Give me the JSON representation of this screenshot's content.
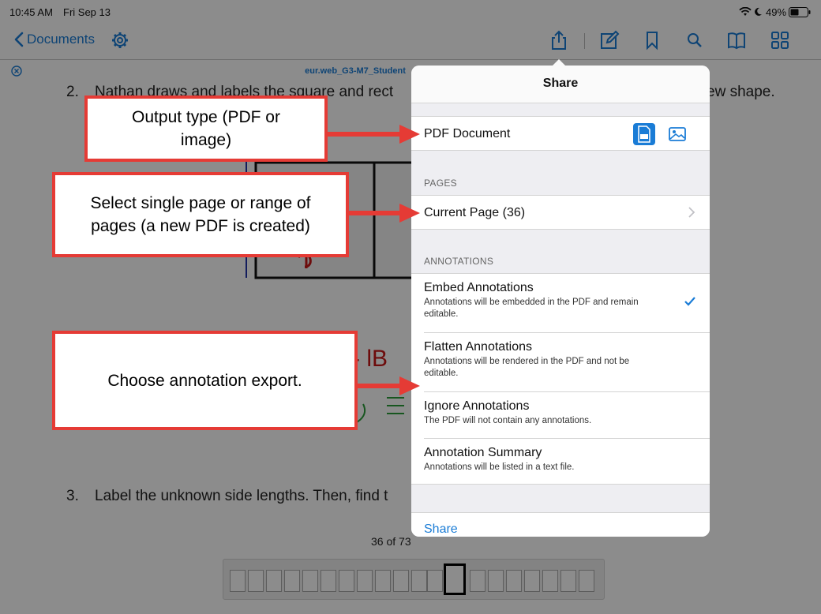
{
  "status": {
    "time": "10:45 AM",
    "date": "Fri Sep 13",
    "battery": "49%"
  },
  "navbar": {
    "back_label": "Documents",
    "icons": [
      "chevron-left-icon",
      "gear-icon",
      "share-icon",
      "edit-icon",
      "bookmark-icon",
      "search-icon",
      "book-icon",
      "grid-icon"
    ]
  },
  "document": {
    "title": "eur.web_G3-M7_Student",
    "q2_number": "2.",
    "q2_text": "Nathan draws and labels the square and rect",
    "q2_tail": "ew shape.",
    "q3_number": "3.",
    "q3_text": "Label the unknown side lengths.  Then, find t",
    "page_counter": "36 of 73"
  },
  "share_popover": {
    "title": "Share",
    "output_row": {
      "label": "PDF Document",
      "selected_format": "pdf"
    },
    "pages_section": "PAGES",
    "pages_row": {
      "label": "Current Page (36)"
    },
    "annotations_section": "ANNOTATIONS",
    "annotation_options": [
      {
        "title": "Embed Annotations",
        "subtitle": "Annotations will be embedded in the PDF and remain editable.",
        "checked": true
      },
      {
        "title": "Flatten Annotations",
        "subtitle": "Annotations will be rendered in the PDF and not be editable.",
        "checked": false
      },
      {
        "title": "Ignore Annotations",
        "subtitle": "The PDF will not contain any annotations.",
        "checked": false
      },
      {
        "title": "Annotation Summary",
        "subtitle": "Annotations will be listed in a text file.",
        "checked": false
      }
    ],
    "share_button": "Share"
  },
  "callouts": {
    "output_type": "Output type (PDF or image)",
    "pages": "Select single page or range of pages (a new PDF is created)",
    "annotations": "Choose annotation export."
  },
  "colors": {
    "accent": "#1a7cd6",
    "callout_red": "#e53b35"
  }
}
